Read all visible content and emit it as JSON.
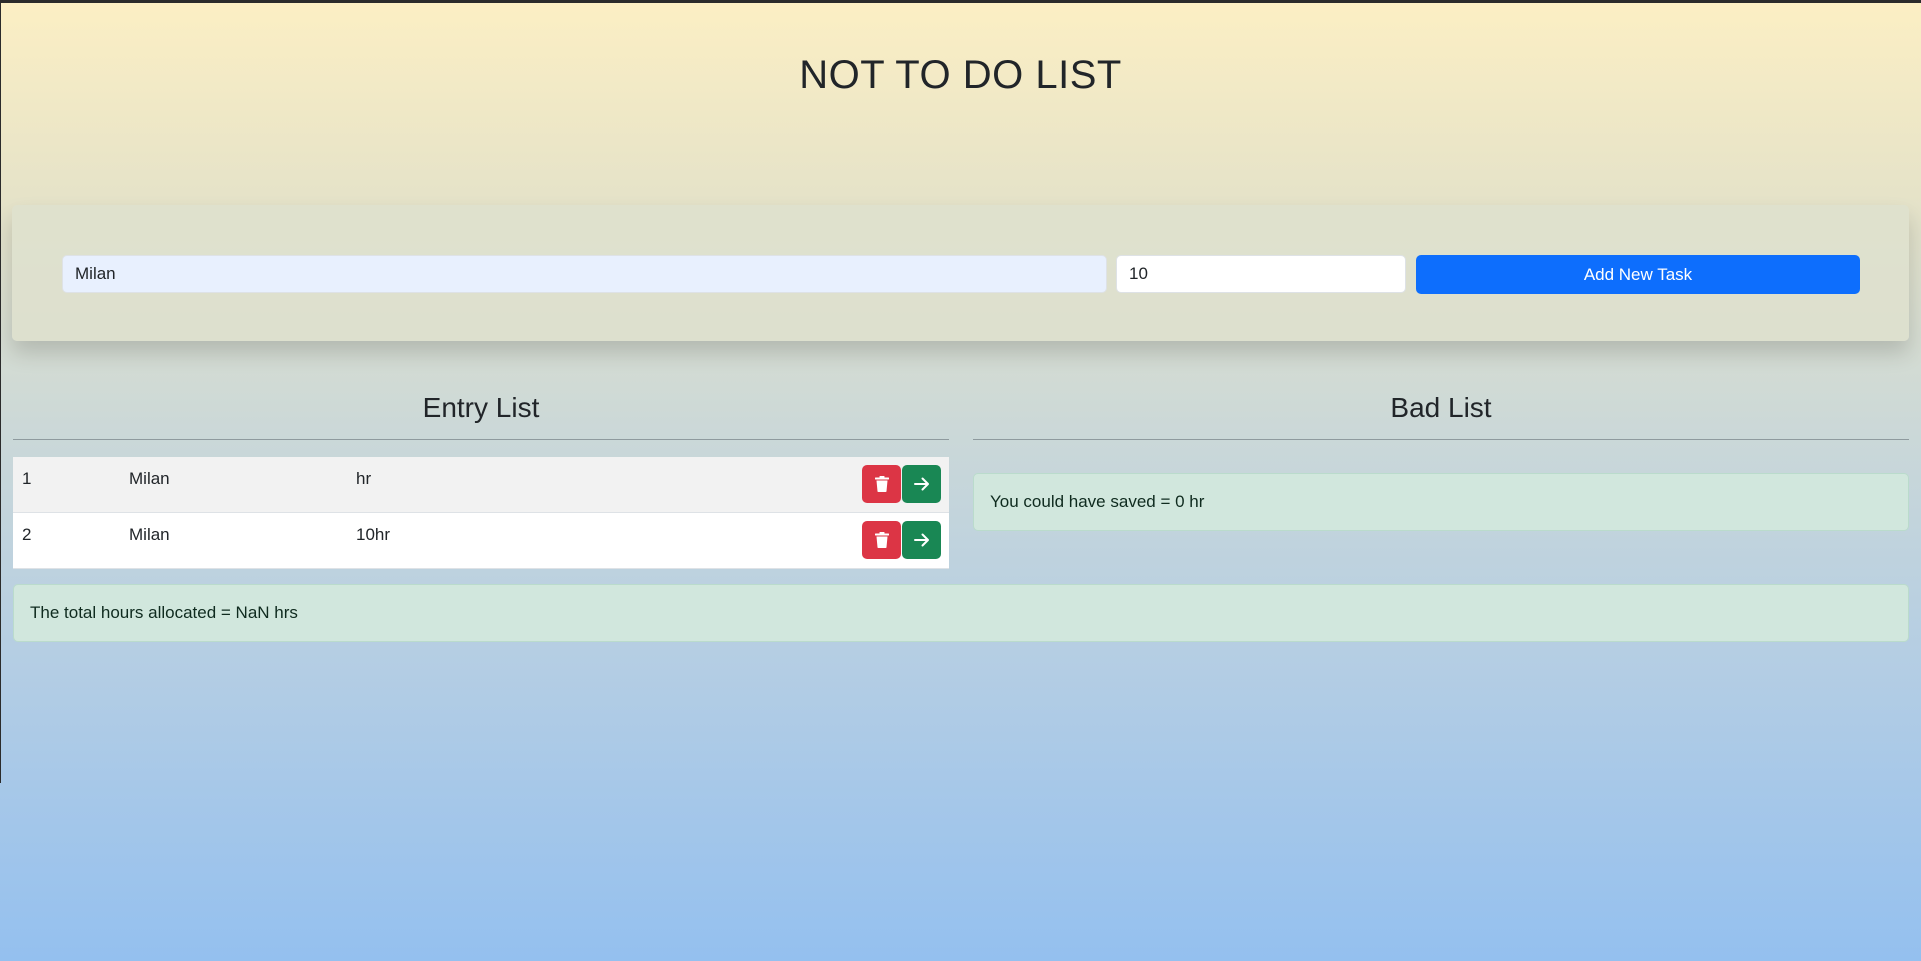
{
  "page": {
    "title": "NOT TO DO LIST"
  },
  "form": {
    "task_value": "Milan",
    "hours_value": "10",
    "add_button_label": "Add New Task"
  },
  "entry_list": {
    "heading": "Entry List",
    "rows": [
      {
        "num": "1",
        "task": "Milan",
        "hours": "hr"
      },
      {
        "num": "2",
        "task": "Milan",
        "hours": "10hr"
      }
    ]
  },
  "bad_list": {
    "heading": "Bad List",
    "saved_text": "You could have saved = 0 hr"
  },
  "summary": {
    "total_text": "The total hours allocated = NaN hrs"
  },
  "icons": {
    "delete": "trash-icon",
    "move": "arrow-right-icon"
  },
  "colors": {
    "primary": "#0d6efd",
    "danger": "#dc3545",
    "success": "#198754",
    "alert_bg": "#d1e7dd"
  }
}
